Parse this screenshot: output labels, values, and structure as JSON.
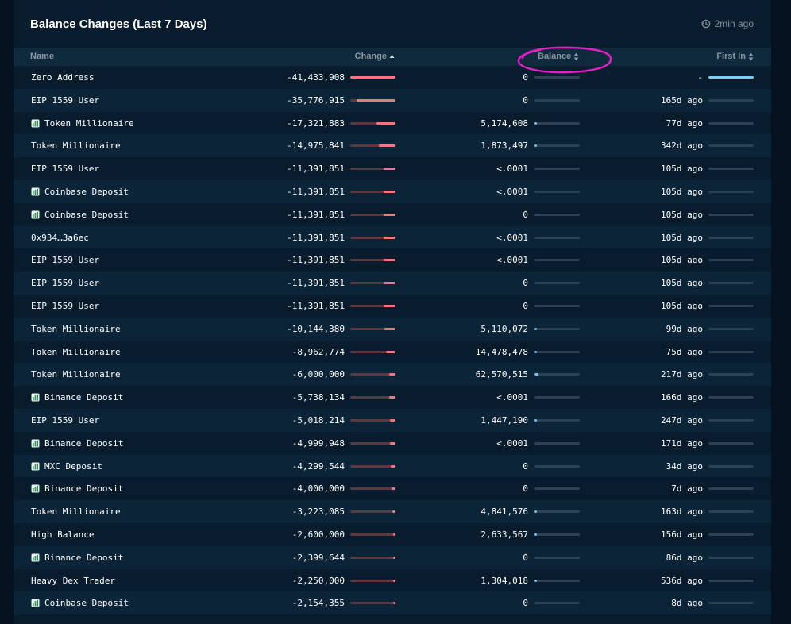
{
  "panel": {
    "title": "Balance Changes (Last 7 Days)",
    "updated": "2min ago",
    "updated_icon": "clock-refresh-icon"
  },
  "columns": {
    "name": "Name",
    "change": "Change",
    "balance": "Balance",
    "first_in": "First In"
  },
  "colors": {
    "change_bar": "#f2777c",
    "balance_bar": "#6ec3ef",
    "first_in_bar": "#78cdf3",
    "annotation": "#e81ec8"
  },
  "rows": [
    {
      "name": "Zero Address",
      "icon": false,
      "change": "-41,433,908",
      "change_frac": 1.0,
      "balance": "0",
      "balance_frac": 0.0,
      "first_in": "-",
      "first_frac": 1.0
    },
    {
      "name": "EIP 1559 User",
      "icon": false,
      "change": "-35,776,915",
      "change_frac": 0.86,
      "balance": "0",
      "balance_frac": 0.0,
      "first_in": "165d ago",
      "first_frac": 0.0
    },
    {
      "name": "Token Millionaire",
      "icon": true,
      "change": "-17,321,883",
      "change_frac": 0.42,
      "balance": "5,174,608",
      "balance_frac": 0.02,
      "first_in": "77d ago",
      "first_frac": 0.0
    },
    {
      "name": "Token Millionaire",
      "icon": false,
      "change": "-14,975,841",
      "change_frac": 0.36,
      "balance": "1,873,497",
      "balance_frac": 0.01,
      "first_in": "342d ago",
      "first_frac": 0.0
    },
    {
      "name": "EIP 1559 User",
      "icon": false,
      "change": "-11,391,851",
      "change_frac": 0.27,
      "balance": "<.0001",
      "balance_frac": 0.0,
      "first_in": "105d ago",
      "first_frac": 0.0
    },
    {
      "name": "Coinbase Deposit",
      "icon": true,
      "change": "-11,391,851",
      "change_frac": 0.27,
      "balance": "<.0001",
      "balance_frac": 0.0,
      "first_in": "105d ago",
      "first_frac": 0.0
    },
    {
      "name": "Coinbase Deposit",
      "icon": true,
      "change": "-11,391,851",
      "change_frac": 0.27,
      "balance": "0",
      "balance_frac": 0.0,
      "first_in": "105d ago",
      "first_frac": 0.0
    },
    {
      "name": "0x934…3a6ec",
      "icon": false,
      "change": "-11,391,851",
      "change_frac": 0.27,
      "balance": "<.0001",
      "balance_frac": 0.0,
      "first_in": "105d ago",
      "first_frac": 0.0
    },
    {
      "name": "EIP 1559 User",
      "icon": false,
      "change": "-11,391,851",
      "change_frac": 0.27,
      "balance": "<.0001",
      "balance_frac": 0.0,
      "first_in": "105d ago",
      "first_frac": 0.0
    },
    {
      "name": "EIP 1559 User",
      "icon": false,
      "change": "-11,391,851",
      "change_frac": 0.27,
      "balance": "0",
      "balance_frac": 0.0,
      "first_in": "105d ago",
      "first_frac": 0.0
    },
    {
      "name": "EIP 1559 User",
      "icon": false,
      "change": "-11,391,851",
      "change_frac": 0.27,
      "balance": "0",
      "balance_frac": 0.0,
      "first_in": "105d ago",
      "first_frac": 0.0
    },
    {
      "name": "Token Millionaire",
      "icon": false,
      "change": "-10,144,380",
      "change_frac": 0.24,
      "balance": "5,110,072",
      "balance_frac": 0.02,
      "first_in": "99d ago",
      "first_frac": 0.0
    },
    {
      "name": "Token Millionaire",
      "icon": false,
      "change": "-8,962,774",
      "change_frac": 0.21,
      "balance": "14,478,478",
      "balance_frac": 0.03,
      "first_in": "75d ago",
      "first_frac": 0.0
    },
    {
      "name": "Token Millionaire",
      "icon": false,
      "change": "-6,000,000",
      "change_frac": 0.14,
      "balance": "62,570,515",
      "balance_frac": 0.08,
      "first_in": "217d ago",
      "first_frac": 0.0
    },
    {
      "name": "Binance Deposit",
      "icon": true,
      "change": "-5,738,134",
      "change_frac": 0.14,
      "balance": "<.0001",
      "balance_frac": 0.0,
      "first_in": "166d ago",
      "first_frac": 0.0
    },
    {
      "name": "EIP 1559 User",
      "icon": false,
      "change": "-5,018,214",
      "change_frac": 0.12,
      "balance": "1,447,190",
      "balance_frac": 0.01,
      "first_in": "247d ago",
      "first_frac": 0.0
    },
    {
      "name": "Binance Deposit",
      "icon": true,
      "change": "-4,999,948",
      "change_frac": 0.12,
      "balance": "<.0001",
      "balance_frac": 0.0,
      "first_in": "171d ago",
      "first_frac": 0.0
    },
    {
      "name": "MXC Deposit",
      "icon": true,
      "change": "-4,299,544",
      "change_frac": 0.1,
      "balance": "0",
      "balance_frac": 0.0,
      "first_in": "34d ago",
      "first_frac": 0.0
    },
    {
      "name": "Binance Deposit",
      "icon": true,
      "change": "-4,000,000",
      "change_frac": 0.09,
      "balance": "0",
      "balance_frac": 0.0,
      "first_in": "7d ago",
      "first_frac": 0.0
    },
    {
      "name": "Token Millionaire",
      "icon": false,
      "change": "-3,223,085",
      "change_frac": 0.07,
      "balance": "4,841,576",
      "balance_frac": 0.02,
      "first_in": "163d ago",
      "first_frac": 0.0
    },
    {
      "name": "High Balance",
      "icon": false,
      "change": "-2,600,000",
      "change_frac": 0.05,
      "balance": "2,633,567",
      "balance_frac": 0.01,
      "first_in": "156d ago",
      "first_frac": 0.0
    },
    {
      "name": "Binance Deposit",
      "icon": true,
      "change": "-2,399,644",
      "change_frac": 0.05,
      "balance": "0",
      "balance_frac": 0.0,
      "first_in": "86d ago",
      "first_frac": 0.0
    },
    {
      "name": "Heavy Dex Trader",
      "icon": false,
      "change": "-2,250,000",
      "change_frac": 0.05,
      "balance": "1,304,018",
      "balance_frac": 0.01,
      "first_in": "536d ago",
      "first_frac": 0.0
    },
    {
      "name": "Coinbase Deposit",
      "icon": true,
      "change": "-2,154,355",
      "change_frac": 0.04,
      "balance": "0",
      "balance_frac": 0.0,
      "first_in": "8d ago",
      "first_frac": 0.0
    }
  ]
}
